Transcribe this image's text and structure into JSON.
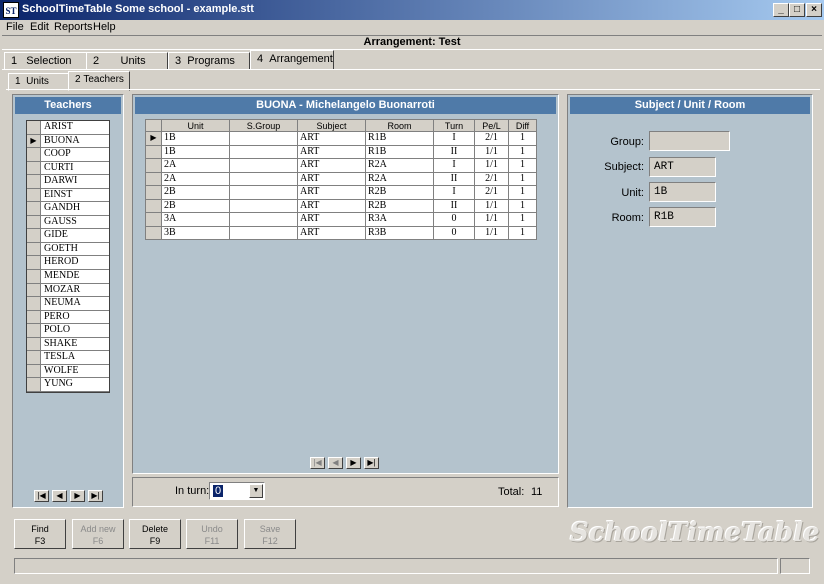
{
  "window": {
    "title": "SchoolTimeTable Some school - example.stt",
    "icon": "app-icon",
    "icon_text": "ST",
    "minimize": "_",
    "maximize": "□",
    "close": "×"
  },
  "menu": [
    "File",
    "Edit",
    "Reports",
    "Help"
  ],
  "header": {
    "title": "Arrangement:  Test"
  },
  "tabs": [
    {
      "num": "1",
      "label": "Selection"
    },
    {
      "num": "2",
      "label": "Units"
    },
    {
      "num": "3",
      "label": "Programs"
    },
    {
      "num": "4",
      "label": "Arrangement"
    }
  ],
  "subtabs": [
    {
      "num": "1",
      "label": "Units"
    },
    {
      "num": "2",
      "label": "Teachers"
    }
  ],
  "teachers_panel": {
    "title": "Teachers",
    "selected_indicator": "▶",
    "items": [
      "ARIST",
      "BUONA",
      "COOP",
      "CURTI",
      "DARWI",
      "EINST",
      "GANDH",
      "GAUSS",
      "GIDE",
      "GOETH",
      "HEROD",
      "MENDE",
      "MOZAR",
      "NEUMA",
      "PERO",
      "POLO",
      "SHAKE",
      "TESLA",
      "WOLFE",
      "YUNG"
    ]
  },
  "main_panel": {
    "title": "BUONA - Michelangelo  Buonarroti",
    "columns": [
      "Unit",
      "S.Group",
      "Subject",
      "Room",
      "Turn",
      "Pe/L",
      "Diff"
    ],
    "rows": [
      [
        "1B",
        "",
        "ART",
        "R1B",
        "I",
        "2/1",
        "1"
      ],
      [
        "1B",
        "",
        "ART",
        "R1B",
        "II",
        "1/1",
        "1"
      ],
      [
        "2A",
        "",
        "ART",
        "R2A",
        "I",
        "1/1",
        "1"
      ],
      [
        "2A",
        "",
        "ART",
        "R2A",
        "II",
        "2/1",
        "1"
      ],
      [
        "2B",
        "",
        "ART",
        "R2B",
        "I",
        "2/1",
        "1"
      ],
      [
        "2B",
        "",
        "ART",
        "R2B",
        "II",
        "1/1",
        "1"
      ],
      [
        "3A",
        "",
        "ART",
        "R3A",
        "0",
        "1/1",
        "1"
      ],
      [
        "3B",
        "",
        "ART",
        "R3B",
        "0",
        "1/1",
        "1"
      ]
    ],
    "in_turn_label": "In turn:",
    "in_turn_value": "0",
    "total_label": "Total:",
    "total_value": "11"
  },
  "nav": {
    "first": "|◀",
    "prev": "◀",
    "next": "▶",
    "last": "▶|"
  },
  "right_panel": {
    "title": "Subject / Unit / Room",
    "group_label": "Group:",
    "group_value": "",
    "subject_label": "Subject:",
    "subject_value": "ART",
    "unit_label": "Unit:",
    "unit_value": "1B",
    "room_label": "Room:",
    "room_value": "R1B"
  },
  "buttons": [
    {
      "label": "Find",
      "key": "F3",
      "enabled": true
    },
    {
      "label": "Add new",
      "key": "F6",
      "enabled": false
    },
    {
      "label": "Delete",
      "key": "F9",
      "enabled": true
    },
    {
      "label": "Undo",
      "key": "F11",
      "enabled": false
    },
    {
      "label": "Save",
      "key": "F12",
      "enabled": false
    }
  ],
  "logo": "SchoolTimeTable"
}
